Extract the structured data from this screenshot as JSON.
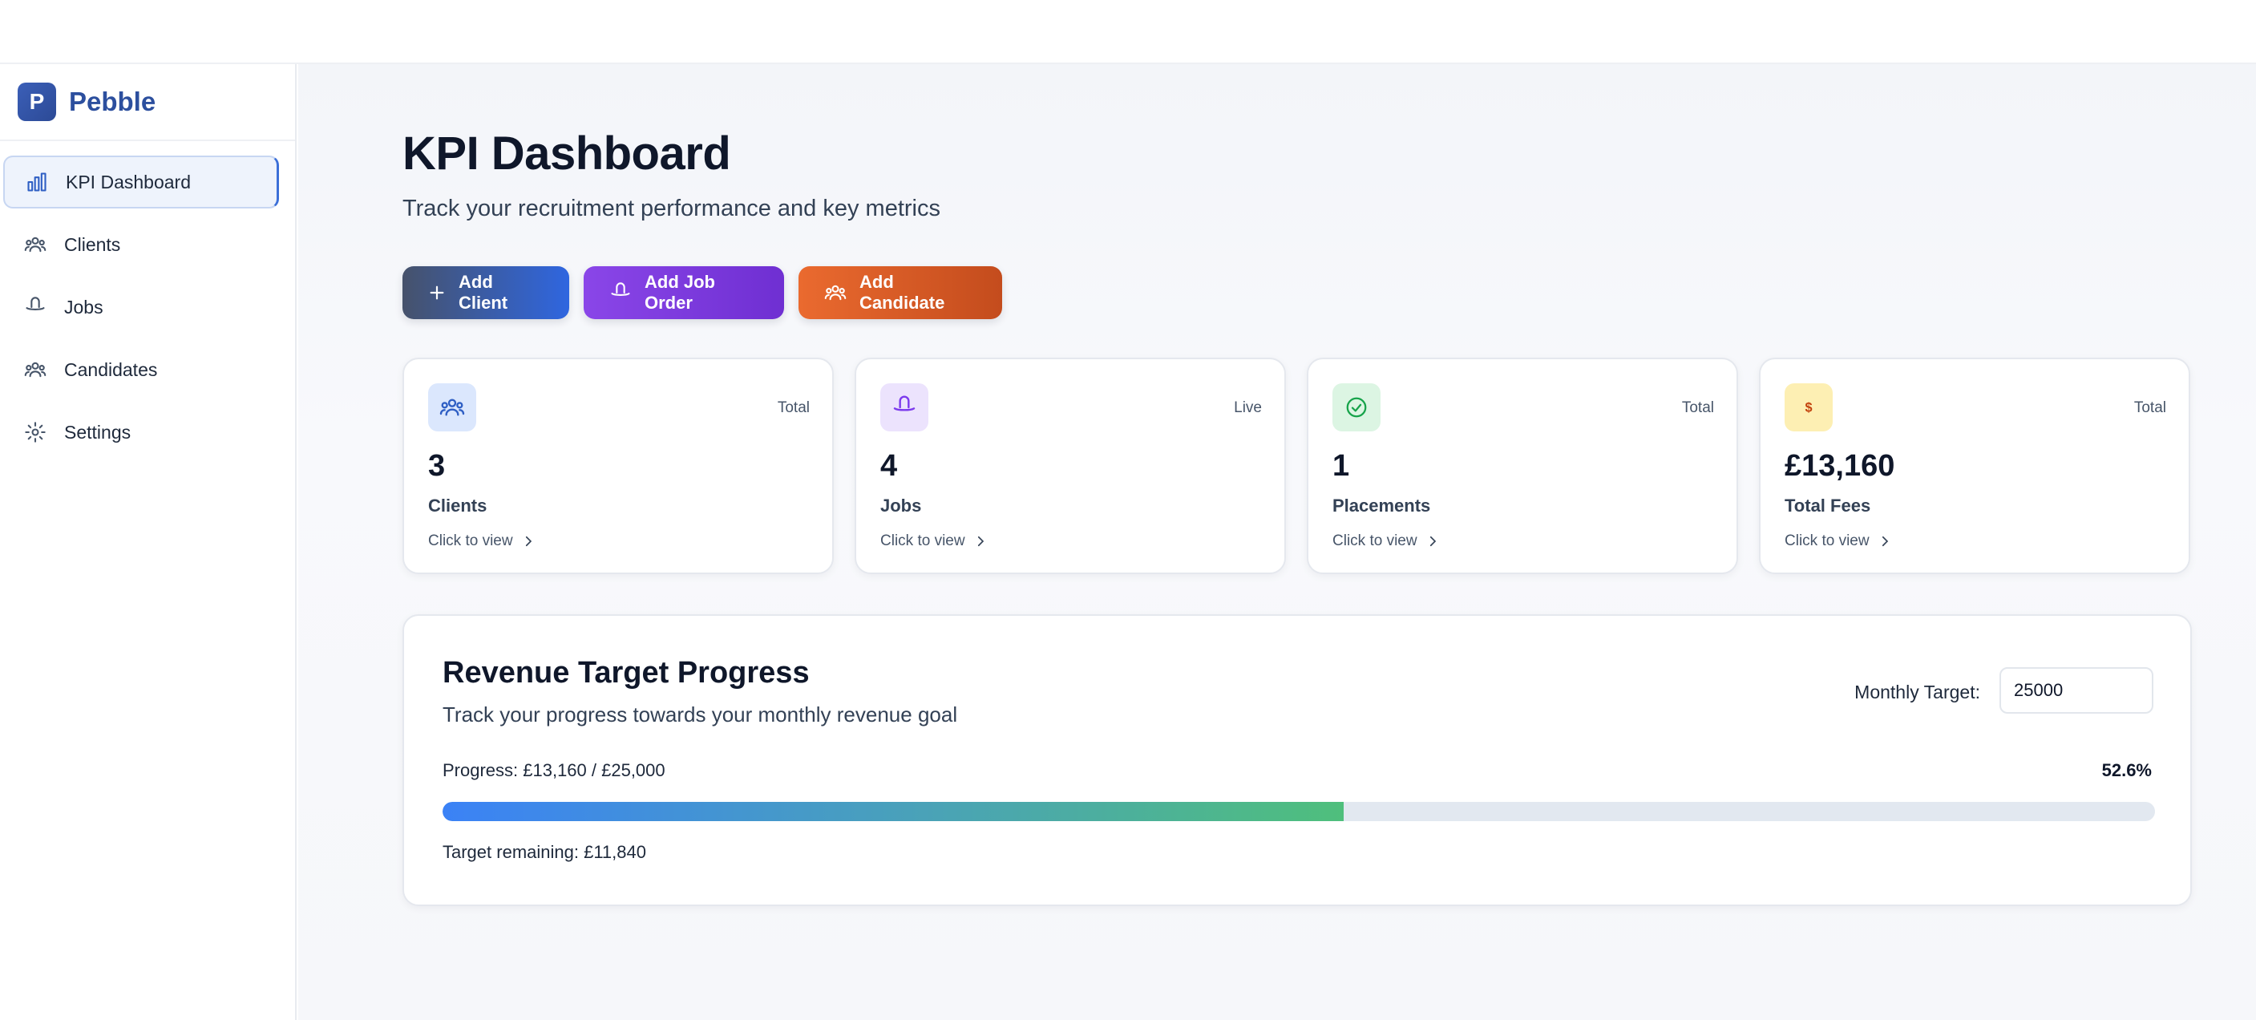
{
  "app": {
    "brand_letter": "P",
    "brand_name": "Pebble"
  },
  "sidebar": {
    "items": [
      {
        "label": "KPI Dashboard",
        "icon": "bar-chart-icon",
        "active": true
      },
      {
        "label": "Clients",
        "icon": "users-icon",
        "active": false
      },
      {
        "label": "Jobs",
        "icon": "hat-icon",
        "active": false
      },
      {
        "label": "Candidates",
        "icon": "users-icon",
        "active": false
      },
      {
        "label": "Settings",
        "icon": "cog-icon",
        "active": false
      }
    ]
  },
  "header": {
    "title": "KPI Dashboard",
    "subtitle": "Track your recruitment performance and key metrics"
  },
  "actions": {
    "add_client": "Add Client",
    "add_job_order": "Add Job Order",
    "add_candidate": "Add Candidate"
  },
  "stats": [
    {
      "tag": "Total",
      "value": "3",
      "label": "Clients",
      "link": "Click to view",
      "icon": "users-icon",
      "color": "#dbe7fd"
    },
    {
      "tag": "Live",
      "value": "4",
      "label": "Jobs",
      "link": "Click to view",
      "icon": "hat-icon",
      "color": "#ece3fd"
    },
    {
      "tag": "Total",
      "value": "1",
      "label": "Placements",
      "link": "Click to view",
      "icon": "check-circle-icon",
      "color": "#dcf5e3"
    },
    {
      "tag": "Total",
      "value": "£13,160",
      "label": "Total Fees",
      "link": "Click to view",
      "icon": "dollar-icon",
      "color": "#fdefb3"
    }
  ],
  "revenue": {
    "title": "Revenue Target Progress",
    "subtitle": "Track your progress towards your monthly revenue goal",
    "target_label": "Monthly Target:",
    "target_value": "25000",
    "progress_text": "Progress: £13,160 / £25,000",
    "progress_percent_text": "52.6%",
    "progress_fraction": 0.526,
    "remaining_text": "Target remaining: £11,840"
  },
  "colors": {
    "accent": "#2f5fc4",
    "btn_client": "#2f66e0",
    "btn_job": "#7c3aed",
    "btn_candidate": "#ea6a2f",
    "progress_start": "#3b82f6",
    "progress_end": "#4fbf7c"
  }
}
